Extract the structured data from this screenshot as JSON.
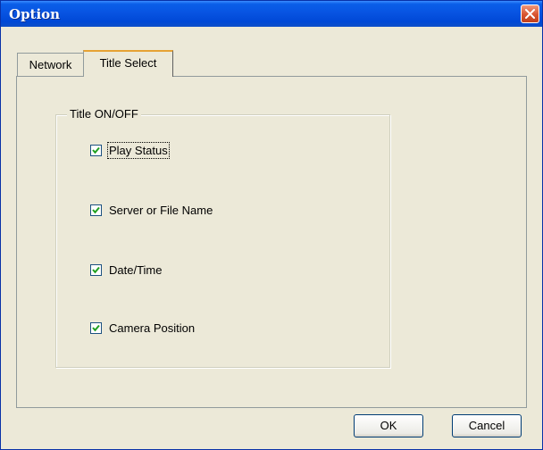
{
  "window": {
    "title": "Option",
    "close_icon": "close-icon"
  },
  "tabs": [
    {
      "label": "Network",
      "selected": false
    },
    {
      "label": "Title Select",
      "selected": true
    }
  ],
  "group": {
    "label": "Title ON/OFF",
    "checkboxes": [
      {
        "label": "Play Status",
        "checked": true,
        "focused": true
      },
      {
        "label": "Server or File Name",
        "checked": true
      },
      {
        "label": "Date/Time",
        "checked": true
      },
      {
        "label": "Camera Position",
        "checked": true
      }
    ]
  },
  "buttons": {
    "ok": "OK",
    "cancel": "Cancel"
  },
  "colors": {
    "titlebar": "#0854e2",
    "dialog_bg": "#ece9d8",
    "close_button": "#d85430",
    "active_tab_accent": "#e6a234"
  }
}
